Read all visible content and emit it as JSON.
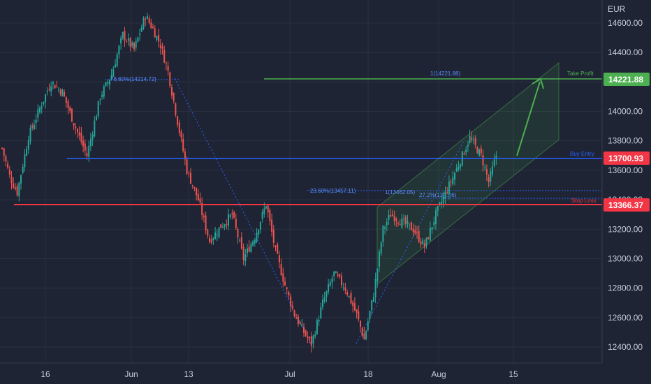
{
  "chart_data": {
    "type": "candlestick",
    "currency": "EUR",
    "ylim": [
      12300,
      14780
    ],
    "y_ticks": [
      "14600.00",
      "14400.00",
      "14200.00",
      "14000.00",
      "13800.00",
      "13600.00",
      "13400.00",
      "13200.00",
      "13000.00",
      "12800.00",
      "12600.00",
      "12400.00"
    ],
    "x_ticks": [
      "16",
      "Jun",
      "13",
      "Jul",
      "18",
      "Aug",
      "15"
    ],
    "levels": {
      "take_profit": {
        "label": "Take Profit",
        "value": "14221.88",
        "color": "#4caf50"
      },
      "entry": {
        "label": "Buy Entry",
        "value": "13700.93",
        "color": "#2962ff"
      },
      "stop_loss": {
        "label": "Stop Loss",
        "value": "13366.37",
        "color": "#f23645"
      }
    },
    "fib_labels": {
      "fib_786": "78.60%(14214.72)",
      "fib_1": "1(14221.88)",
      "fib_236": "23.60%(13457.11)",
      "fib_1_low": "1(13462.05)",
      "fib_27": "27.2%(13(...)6)"
    },
    "candle_color_up": "#26a69a",
    "candle_color_down": "#ef5350",
    "path_nodes": [
      {
        "i": 0,
        "v": 13750
      },
      {
        "i": 4,
        "v": 13560
      },
      {
        "i": 8,
        "v": 13450
      },
      {
        "i": 14,
        "v": 13830
      },
      {
        "i": 20,
        "v": 14020
      },
      {
        "i": 26,
        "v": 14200
      },
      {
        "i": 32,
        "v": 14130
      },
      {
        "i": 38,
        "v": 13920
      },
      {
        "i": 45,
        "v": 13700
      },
      {
        "i": 52,
        "v": 14100
      },
      {
        "i": 58,
        "v": 14250
      },
      {
        "i": 64,
        "v": 14520
      },
      {
        "i": 70,
        "v": 14420
      },
      {
        "i": 76,
        "v": 14650
      },
      {
        "i": 80,
        "v": 14560
      },
      {
        "i": 84,
        "v": 14450
      },
      {
        "i": 88,
        "v": 14270
      },
      {
        "i": 92,
        "v": 14000
      },
      {
        "i": 95,
        "v": 13800
      },
      {
        "i": 98,
        "v": 13600
      },
      {
        "i": 104,
        "v": 13400
      },
      {
        "i": 110,
        "v": 13120
      },
      {
        "i": 116,
        "v": 13220
      },
      {
        "i": 122,
        "v": 13300
      },
      {
        "i": 128,
        "v": 13000
      },
      {
        "i": 134,
        "v": 13150
      },
      {
        "i": 140,
        "v": 13370
      },
      {
        "i": 145,
        "v": 13050
      },
      {
        "i": 150,
        "v": 12820
      },
      {
        "i": 155,
        "v": 12620
      },
      {
        "i": 160,
        "v": 12500
      },
      {
        "i": 164,
        "v": 12420
      },
      {
        "i": 170,
        "v": 12700
      },
      {
        "i": 176,
        "v": 12900
      },
      {
        "i": 182,
        "v": 12800
      },
      {
        "i": 188,
        "v": 12620
      },
      {
        "i": 192,
        "v": 12450
      },
      {
        "i": 197,
        "v": 12760
      },
      {
        "i": 202,
        "v": 13200
      },
      {
        "i": 206,
        "v": 13300
      },
      {
        "i": 212,
        "v": 13250
      },
      {
        "i": 218,
        "v": 13200
      },
      {
        "i": 224,
        "v": 13080
      },
      {
        "i": 230,
        "v": 13300
      },
      {
        "i": 236,
        "v": 13470
      },
      {
        "i": 242,
        "v": 13640
      },
      {
        "i": 248,
        "v": 13820
      },
      {
        "i": 254,
        "v": 13700
      },
      {
        "i": 258,
        "v": 13520
      },
      {
        "i": 262,
        "v": 13700
      }
    ]
  }
}
